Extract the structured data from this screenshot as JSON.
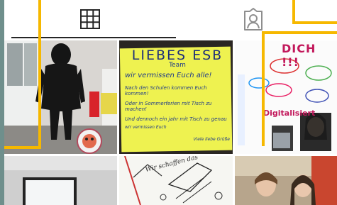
{
  "tabs": [
    {
      "name": "grid",
      "icon": "grid-icon",
      "active": true
    },
    {
      "name": "tagged",
      "icon": "tagged-person-icon",
      "active": false
    }
  ],
  "posts": [
    {
      "id": 1,
      "kind": "photo",
      "subject": "person in black hoodie standing in a room",
      "badge_icon": "sticker-face-icon"
    },
    {
      "id": 2,
      "kind": "poster",
      "lines": [
        "LIEBES ESB",
        "Team",
        "wir vermissen Euch alle!",
        "Nach den Schulen kommen Euch kommen!",
        "Oder in Sommerferien mit Tisch zu machen!",
        "Und dennoch ein jahr mit Tisch zu genau",
        "wir vermissen Euch",
        "Viele liebe Grüße"
      ]
    },
    {
      "id": 3,
      "kind": "collage",
      "headline": "DICH !!!",
      "side_text": "Digitalisiert"
    },
    {
      "id": 4,
      "kind": "photo",
      "subject": "laptop screen on a desk"
    },
    {
      "id": 5,
      "kind": "drawing",
      "text": "Wir schaffen das"
    },
    {
      "id": 6,
      "kind": "photo",
      "subject": "two people smiling"
    }
  ],
  "highlight_color": "#f6b800"
}
